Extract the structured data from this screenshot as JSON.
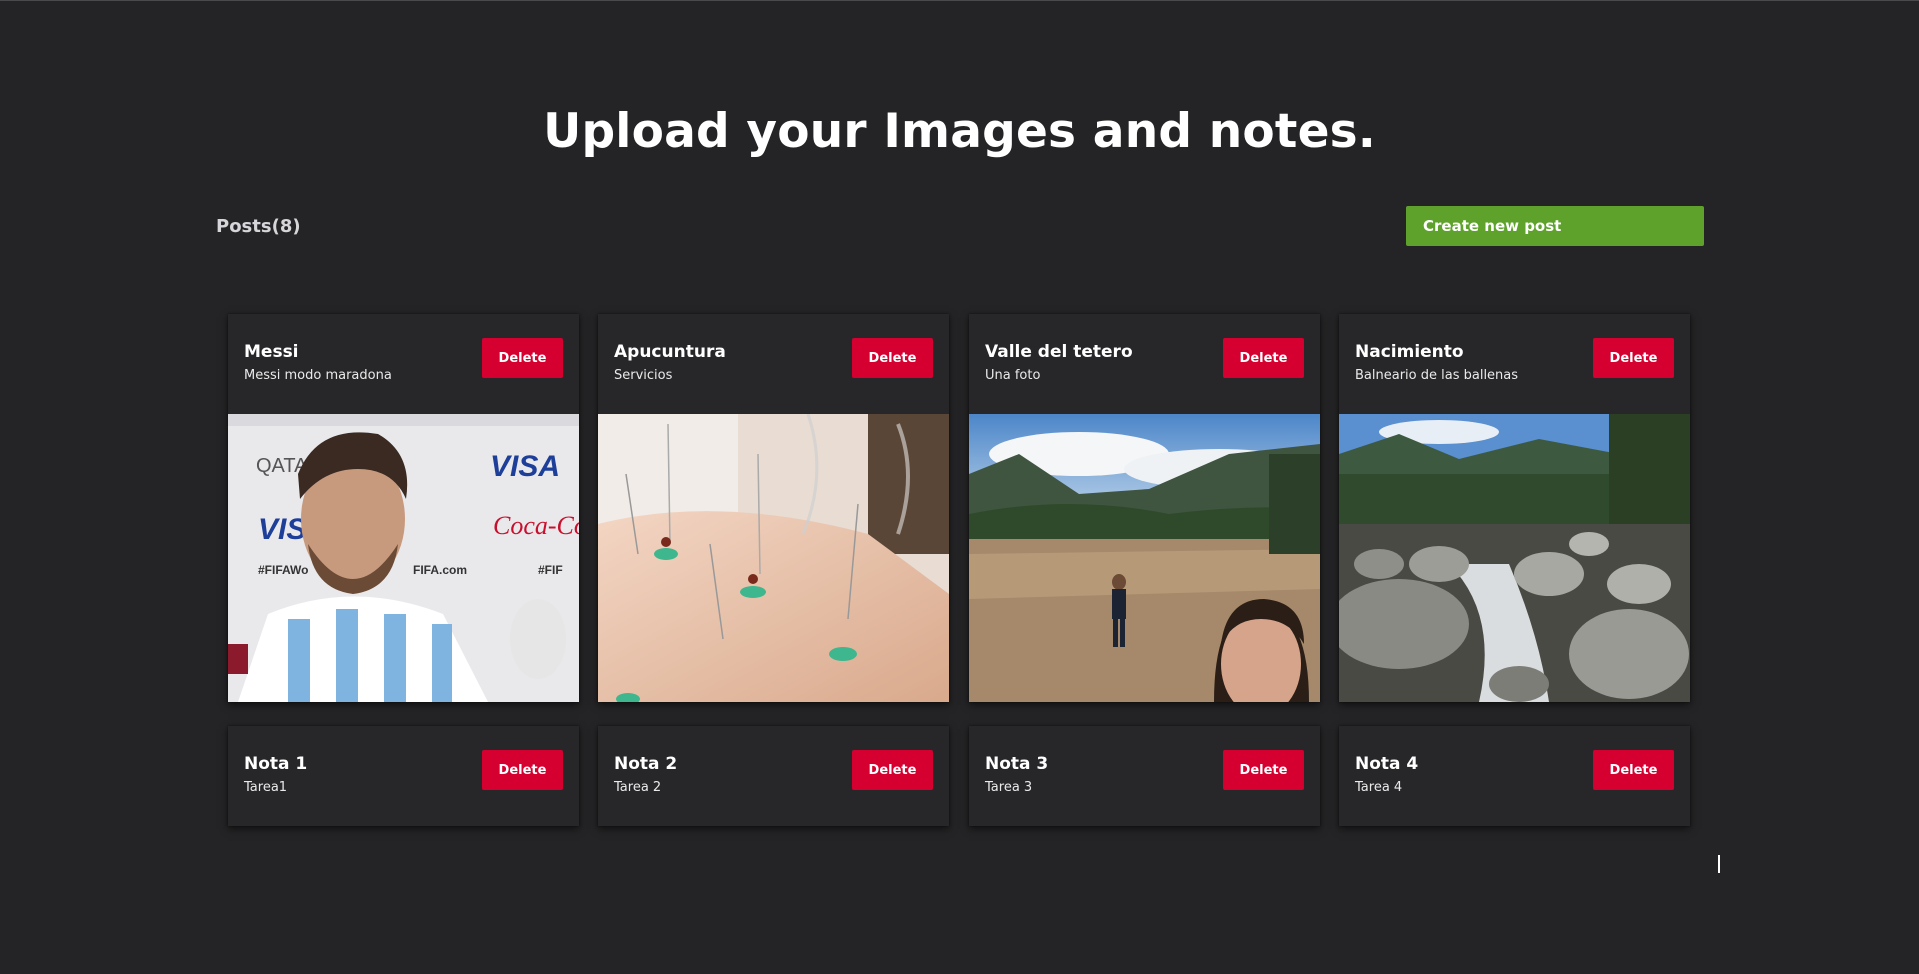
{
  "page": {
    "title": "Upload your Images and notes."
  },
  "toolbar": {
    "posts_count": "Posts(8)",
    "create_label": "Create new post"
  },
  "colors": {
    "background": "#242426",
    "card": "#27272a",
    "create_button": "#5ea22c",
    "delete_button": "#d5002f"
  },
  "posts": [
    {
      "title": "Messi",
      "subtitle": "Messi modo maradona",
      "delete_label": "Delete",
      "image": "messi-interview-photo"
    },
    {
      "title": "Apucuntura",
      "subtitle": "Servicios",
      "delete_label": "Delete",
      "image": "acupuncture-needles-photo"
    },
    {
      "title": "Valle del tetero",
      "subtitle": "Una foto",
      "delete_label": "Delete",
      "image": "mountain-valley-photo"
    },
    {
      "title": "Nacimiento",
      "subtitle": "Balneario de las ballenas",
      "delete_label": "Delete",
      "image": "river-rocks-photo"
    }
  ],
  "notes": [
    {
      "title": "Nota 1",
      "subtitle": "Tarea1",
      "delete_label": "Delete"
    },
    {
      "title": "Nota 2",
      "subtitle": "Tarea 2",
      "delete_label": "Delete"
    },
    {
      "title": "Nota 3",
      "subtitle": "Tarea 3",
      "delete_label": "Delete"
    },
    {
      "title": "Nota 4",
      "subtitle": "Tarea 4",
      "delete_label": "Delete"
    }
  ]
}
